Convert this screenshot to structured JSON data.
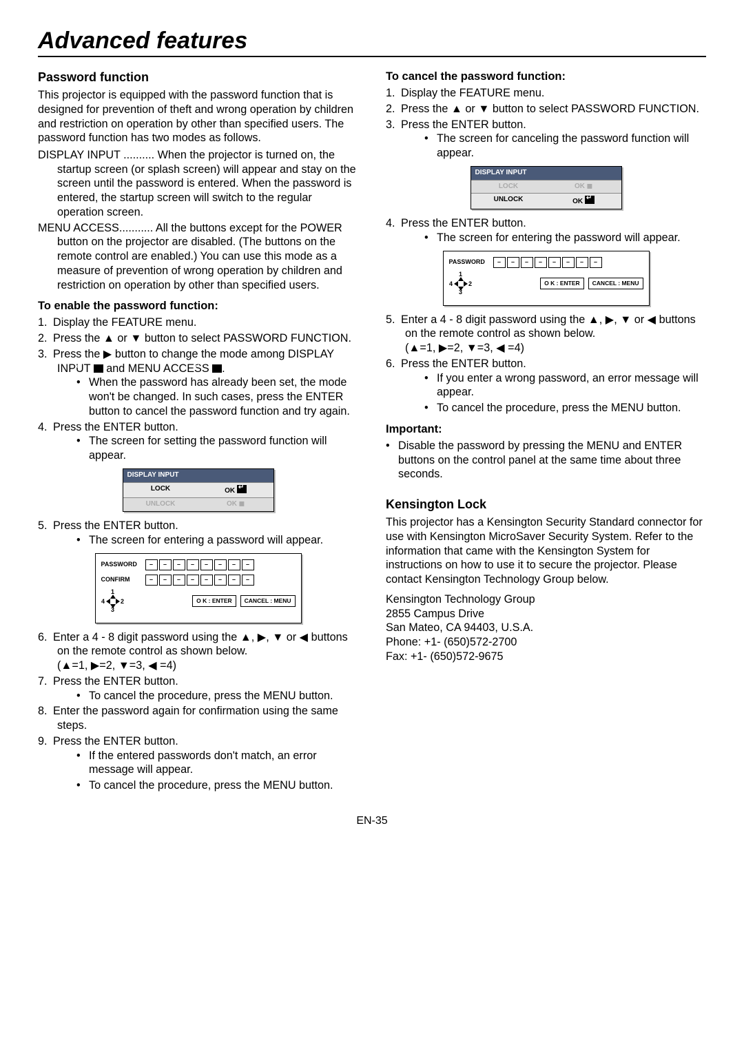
{
  "page_title": "Advanced features",
  "page_number": "EN-35",
  "left": {
    "h_password": "Password function",
    "p_intro": "This projector is equipped with the password function that is designed for prevention of theft and wrong operation by children and restriction on operation by other than specified users. The password function has two modes as follows.",
    "mode_display": "DISPLAY INPUT .......... When the projector is turned on, the startup screen (or splash screen) will appear and stay on the screen until the password is entered. When the password is entered, the startup screen will switch to the regular operation screen.",
    "mode_menu": "MENU ACCESS........... All the buttons except for the POWER button on the projector are disabled. (The buttons on the remote control are enabled.) You can use this mode as a measure of prevention of wrong operation by children and restriction on operation by other than specified users.",
    "h_enable": "To enable the password function:",
    "s1": "Display the FEATURE menu.",
    "s2a": "Press the ",
    "s2b": " or ",
    "s2c": " button to select PASSWORD FUNCTION.",
    "s3a": "Press the ",
    "s3b": " button to change the mode among DISPLAY INPUT ",
    "s3c": " and MENU ACCESS ",
    "s3d": ".",
    "s3_bul": "When the password has already been set, the mode won't be changed. In such cases, press the ENTER button to cancel the password function and try again.",
    "s4": "Press the ENTER button.",
    "s4_bul": "The screen for setting the password function will appear.",
    "s5": "Press the ENTER button.",
    "s5_bul": "The screen for entering a password will appear.",
    "s6a": "Enter a 4 - 8 digit password using the ",
    "s6b": " or ",
    "s6c": " buttons on the remote control as shown below.",
    "s6_map": "(▲=1, ▶=2, ▼=3, ◀ =4)",
    "s7": "Press the ENTER button.",
    "s7_bul": "To cancel the procedure, press the MENU button.",
    "s8": "Enter the password again for confirmation using the same steps.",
    "s9": "Press the ENTER button.",
    "s9_bul1": "If the entered passwords don't match, an error message will appear.",
    "s9_bul2": "To cancel the procedure, press the MENU button."
  },
  "right": {
    "h_cancel": "To cancel the password function:",
    "c1": "Display the FEATURE menu.",
    "c2a": "Press the ",
    "c2b": " or ",
    "c2c": " button to select PASSWORD FUNCTION.",
    "c3": "Press the ENTER button.",
    "c3_bul": "The screen for canceling the password function will appear.",
    "c4": "Press the ENTER button.",
    "c4_bul": "The screen for entering the password will appear.",
    "c5a": "Enter a 4 - 8 digit password using the ",
    "c5b": " or ",
    "c5c": " buttons on the remote control as shown below.",
    "c5_map": "(▲=1, ▶=2, ▼=3, ◀ =4)",
    "c6": "Press the ENTER button.",
    "c6_bul1": "If you enter a wrong password, an error message will appear.",
    "c6_bul2": "To cancel the procedure, press the MENU button.",
    "h_important": "Important:",
    "imp_bul": "Disable the password by pressing the MENU and ENTER buttons on the control panel at the same time about three seconds.",
    "h_kens": "Kensington Lock",
    "kens_p": "This projector has a Kensington Security Standard connector for use with Kensington MicroSaver Security System. Refer to the information that came with the Kensington System for instructions on how to use it to secure the projector. Please contact Kensington Technology Group below.",
    "kens_addr1": "Kensington Technology Group",
    "kens_addr2": "2855 Campus Drive",
    "kens_addr3": "San Mateo, CA 94403, U.S.A.",
    "kens_phone": "Phone: +1- (650)572-2700",
    "kens_fax": "Fax: +1- (650)572-9675"
  },
  "osd": {
    "display_input": "DISPLAY INPUT",
    "lock": "LOCK",
    "unlock": "UNLOCK",
    "ok": "OK",
    "password": "PASSWORD",
    "confirm": "CONFIRM",
    "ok_enter": "O K : ENTER",
    "cancel_menu": "CANCEL : MENU",
    "n1": "1",
    "n2": "2",
    "n3": "3",
    "n4": "4",
    "dash": "–"
  },
  "glyph": {
    "up": "▲",
    "down": "▼",
    "left": "◀",
    "right": "▶",
    "sep": ", "
  }
}
